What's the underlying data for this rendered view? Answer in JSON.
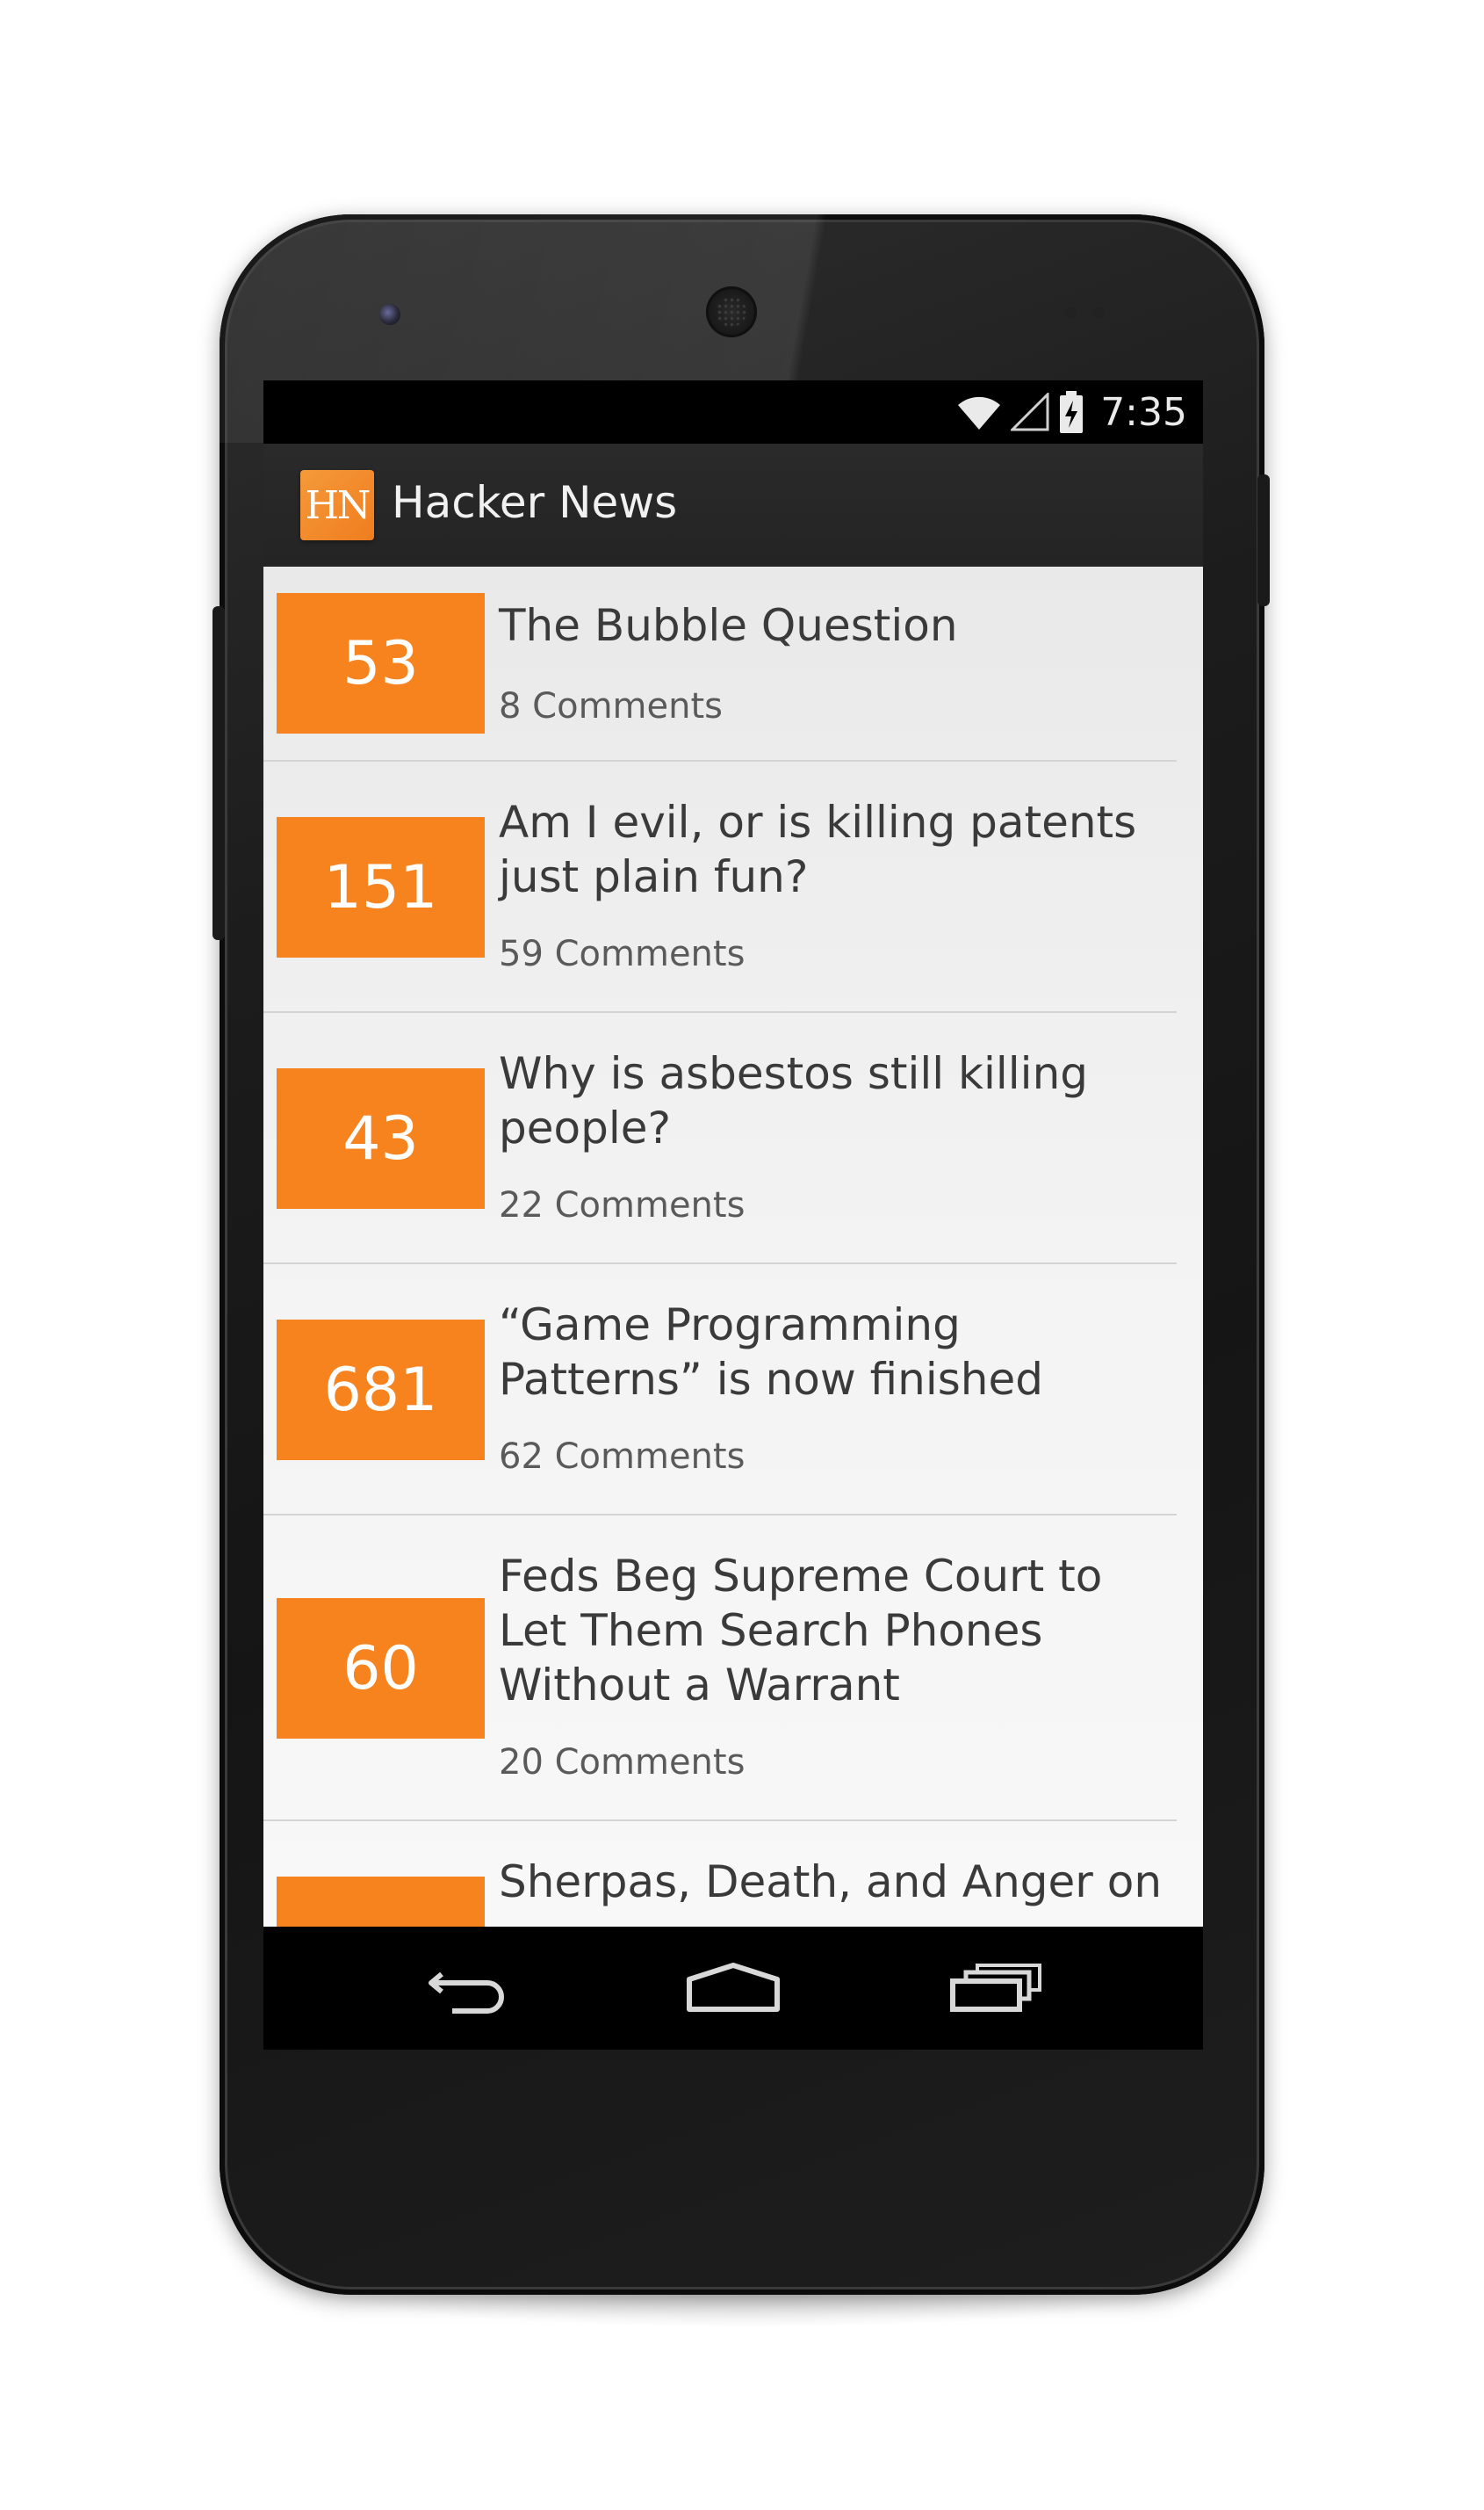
{
  "status_bar": {
    "time": "7:35",
    "icons": [
      "wifi-icon",
      "signal-icon",
      "battery-charging-icon"
    ]
  },
  "action_bar": {
    "logo_text": "HN",
    "title": "Hacker News"
  },
  "colors": {
    "accent": "#f7831f",
    "action_bar": "#262626",
    "list_background": "#efefef"
  },
  "stories": [
    {
      "score": "53",
      "title": "The Bubble Question",
      "comments": "8 Comments"
    },
    {
      "score": "151",
      "title": "Am I evil, or is killing patents just plain fun?",
      "comments": "59 Comments"
    },
    {
      "score": "43",
      "title": "Why is asbestos still killing people?",
      "comments": "22 Comments"
    },
    {
      "score": "681",
      "title": "“Game Programming Patterns” is now finished",
      "comments": "62 Comments"
    },
    {
      "score": "60",
      "title": "Feds Beg Supreme Court to Let Them Search Phones Without a Warrant",
      "comments": "20 Comments"
    },
    {
      "score": "",
      "title": "Sherpas, Death, and Anger on",
      "comments": ""
    }
  ],
  "nav_bar": {
    "buttons": [
      "back-icon",
      "home-icon",
      "recents-icon"
    ]
  }
}
